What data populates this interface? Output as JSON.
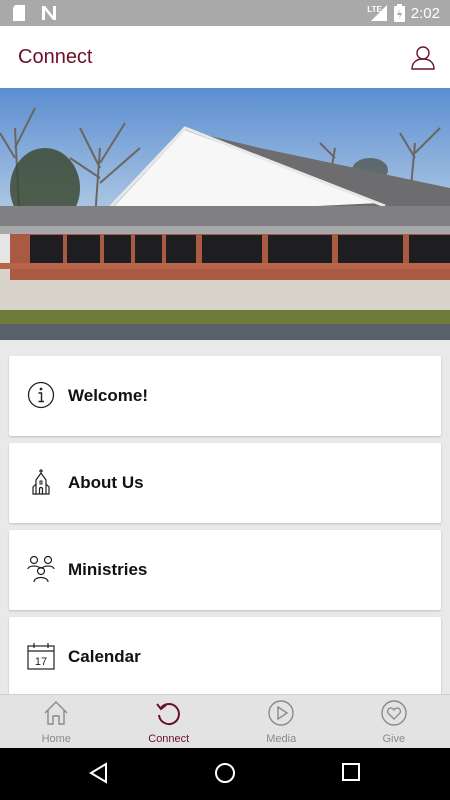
{
  "status_bar": {
    "time": "2:02",
    "network": "LTE",
    "icons": [
      "sd-card-icon",
      "n-notification-icon",
      "signal-icon",
      "battery-icon"
    ]
  },
  "app_bar": {
    "title": "Connect",
    "profile_icon": "user-icon"
  },
  "hero": {
    "image": "church-building-photo"
  },
  "menu": {
    "items": [
      {
        "label": "Welcome!",
        "icon": "info-icon"
      },
      {
        "label": "About Us",
        "icon": "church-icon"
      },
      {
        "label": "Ministries",
        "icon": "people-group-icon"
      },
      {
        "label": "Calendar",
        "icon": "calendar-icon",
        "icon_text": "17"
      }
    ]
  },
  "bottom_nav": {
    "items": [
      {
        "label": "Home",
        "icon": "home-icon"
      },
      {
        "label": "Connect",
        "icon": "connect-icon",
        "active": true
      },
      {
        "label": "Media",
        "icon": "play-icon"
      },
      {
        "label": "Give",
        "icon": "heart-icon"
      }
    ]
  },
  "colors": {
    "accent": "#6b1028",
    "status_bar": "#a9a9a9",
    "nav_inactive": "#8a8a8a"
  }
}
